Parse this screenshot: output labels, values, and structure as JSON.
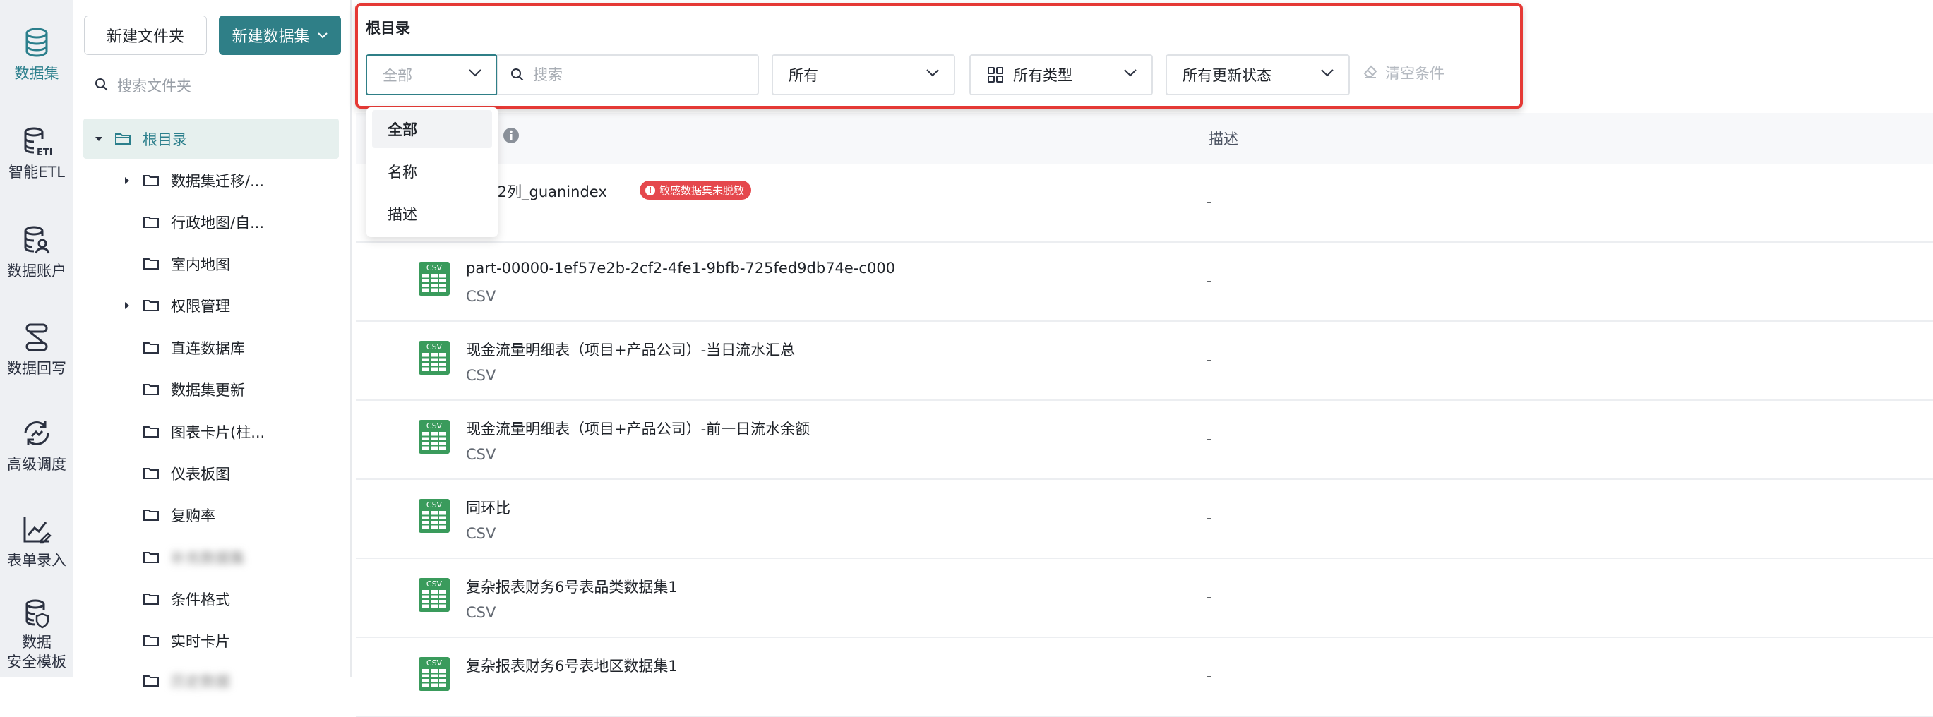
{
  "rail": {
    "items": [
      {
        "label": "数据集",
        "icon": "database-icon",
        "active": true
      },
      {
        "label": "智能ETL",
        "icon": "etl-icon"
      },
      {
        "label": "数据账户",
        "icon": "data-account-icon"
      },
      {
        "label": "数据回写",
        "icon": "writeback-icon"
      },
      {
        "label": "高级调度",
        "icon": "schedule-icon"
      },
      {
        "label": "表单录入",
        "icon": "form-entry-icon"
      },
      {
        "label_line1": "数据",
        "label_line2": "安全模板",
        "icon": "security-template-icon"
      }
    ]
  },
  "folder_panel": {
    "new_folder_label": "新建文件夹",
    "new_dataset_label": "新建数据集",
    "search_placeholder": "搜索文件夹",
    "tree": [
      {
        "label": "根目录",
        "root": true,
        "expanded": true
      },
      {
        "label": "数据集迁移/...",
        "has_children": true
      },
      {
        "label": "行政地图/自..."
      },
      {
        "label": "室内地图"
      },
      {
        "label": "权限管理",
        "has_children": true
      },
      {
        "label": "直连数据库"
      },
      {
        "label": "数据集更新"
      },
      {
        "label": "图表卡片(柱..."
      },
      {
        "label": "仪表板图"
      },
      {
        "label": "复购率"
      },
      {
        "label": "补充数据集",
        "blurred": true
      },
      {
        "label": "条件格式"
      },
      {
        "label": "实时卡片"
      },
      {
        "label": "历史数据",
        "blurred": true
      }
    ]
  },
  "filters": {
    "title": "根目录",
    "scope_value": "全部",
    "search_placeholder": "搜索",
    "owner_value": "所有",
    "type_value": "所有类型",
    "status_value": "所有更新状态",
    "clear_label": "清空条件"
  },
  "scope_dropdown": {
    "options": [
      "全部",
      "名称",
      "描述"
    ],
    "selected": "全部"
  },
  "table": {
    "desc_header": "描述",
    "rows": [
      {
        "name": "W_12列_guanindex",
        "type": "",
        "desc": "-",
        "badge": "敏感数据集未脱敏"
      },
      {
        "name": "part-00000-1ef57e2b-2cf2-4fe1-9bfb-725fed9db74e-c000",
        "type": "CSV",
        "desc": "-"
      },
      {
        "name": "现金流量明细表（项目+产品公司）-当日流水汇总",
        "type": "CSV",
        "desc": "-"
      },
      {
        "name": "现金流量明细表（项目+产品公司）-前一日流水余额",
        "type": "CSV",
        "desc": "-"
      },
      {
        "name": "同环比",
        "type": "CSV",
        "desc": "-"
      },
      {
        "name": "复杂报表财务6号表品类数据集1",
        "type": "CSV",
        "desc": "-"
      },
      {
        "name": "复杂报表财务6号表地区数据集1",
        "type": "CSV",
        "desc": "-"
      }
    ]
  },
  "colors": {
    "accent": "#2f7f87",
    "highlight_border": "#e53935",
    "badge": "#e5484d",
    "csv_green": "#3a9b5c"
  }
}
